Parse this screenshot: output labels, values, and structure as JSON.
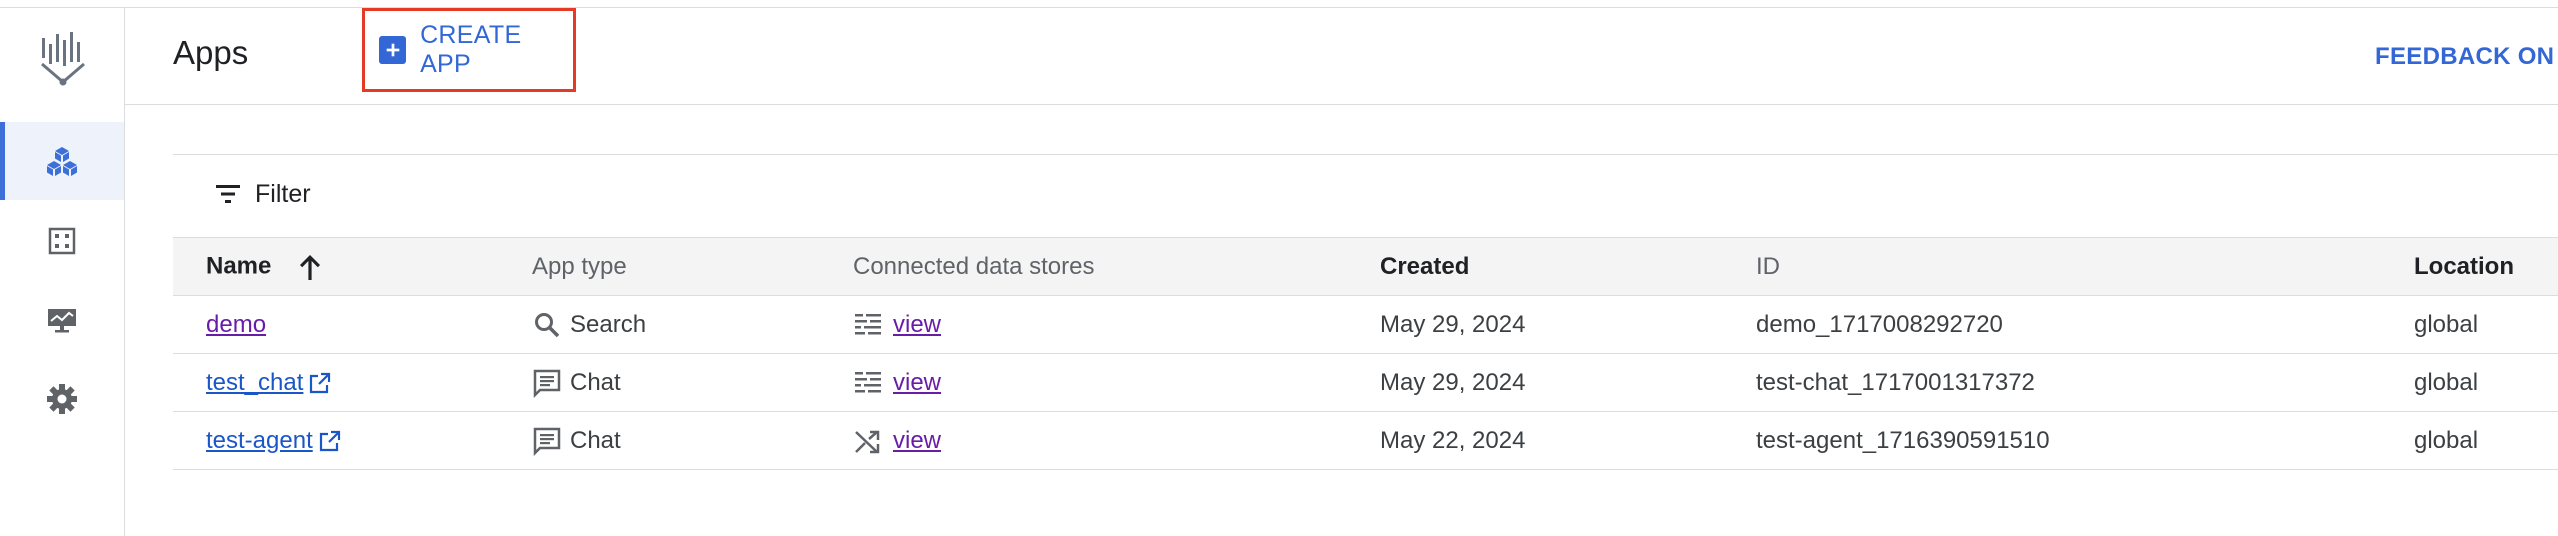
{
  "header": {
    "title": "Apps",
    "create_button": "CREATE APP",
    "feedback_link": "FEEDBACK ON A"
  },
  "nav_rail": {
    "icons": [
      "vertex-logo-icon",
      "apps-cube-icon",
      "data-grid-icon",
      "monitor-icon",
      "settings-gear-icon"
    ],
    "active": "apps-cube-icon"
  },
  "filter": {
    "label": "Filter"
  },
  "table": {
    "columns": [
      "Name",
      "App type",
      "Connected data stores",
      "Created",
      "ID",
      "Location"
    ],
    "sort": {
      "column": "Name",
      "direction": "ascending"
    },
    "rows": [
      {
        "name": "demo",
        "external": false,
        "app_type": "Search",
        "type_icon": "search-icon",
        "ds_icon": "datastore-list-icon",
        "data_stores": "view",
        "created": "May 29, 2024",
        "id": "demo_1717008292720",
        "location": "global"
      },
      {
        "name": "test_chat",
        "external": true,
        "app_type": "Chat",
        "type_icon": "chat-icon",
        "ds_icon": "datastore-list-icon",
        "data_stores": "view",
        "created": "May 29, 2024",
        "id": "test-chat_1717001317372",
        "location": "global"
      },
      {
        "name": "test-agent",
        "external": true,
        "app_type": "Chat",
        "type_icon": "chat-icon",
        "ds_icon": "shuffle-icon",
        "data_stores": "view",
        "created": "May 22, 2024",
        "id": "test-agent_1716390591510",
        "location": "global"
      }
    ]
  },
  "colors": {
    "accent": "#3367d6",
    "highlight_border": "#e53a25",
    "visited_link": "#681da8"
  }
}
